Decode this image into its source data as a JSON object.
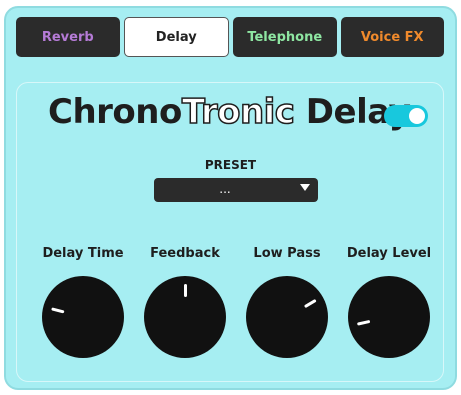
{
  "tabs": [
    {
      "label": "Reverb",
      "color": "#b57bd6",
      "active": false
    },
    {
      "label": "Delay",
      "color": "#222222",
      "active": true
    },
    {
      "label": "Telephone",
      "color": "#8ee6a2",
      "active": false
    },
    {
      "label": "Voice FX",
      "color": "#f08a2c",
      "active": false
    }
  ],
  "plugin": {
    "title_part1": "Chrono",
    "title_part2": "Tronic",
    "title_part3": " Delay",
    "enabled": true,
    "accent": "#18c8dd"
  },
  "preset": {
    "label": "PRESET",
    "value": "..."
  },
  "knobs": [
    {
      "label": "Delay Time",
      "level": 0.22
    },
    {
      "label": "Feedback",
      "level": 0.5
    },
    {
      "label": "Low Pass",
      "level": 0.72
    },
    {
      "label": "Delay Level",
      "level": 0.12
    }
  ]
}
